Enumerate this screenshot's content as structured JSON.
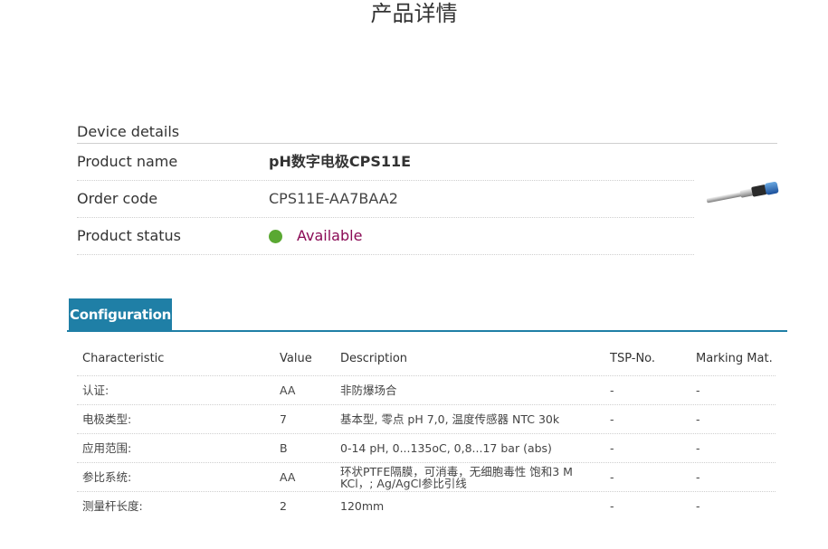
{
  "page_title": "产品详情",
  "device": {
    "heading": "Device details",
    "product_name_label": "Product name",
    "product_name_value": "pH数字电极CPS11E",
    "order_code_label": "Order code",
    "order_code_value": "CPS11E-AA7BAA2",
    "status_label": "Product status",
    "status_value": "Available",
    "status_color": "#5aa832",
    "product_image_icon": "ph-electrode-image"
  },
  "config": {
    "tab_label": "Configuration",
    "accent_color": "#1f7fa6",
    "columns": [
      "Characteristic",
      "Value",
      "Description",
      "TSP-No.",
      "Marking Mat."
    ],
    "rows": [
      {
        "characteristic": "认证:",
        "value": "AA",
        "description": "非防爆场合",
        "tsp": "-",
        "marking": "-"
      },
      {
        "characteristic": "电极类型:",
        "value": "7",
        "description": "基本型, 零点 pH 7,0, 温度传感器 NTC 30k",
        "tsp": "-",
        "marking": "-"
      },
      {
        "characteristic": "应用范围:",
        "value": "B",
        "description": "0-14 pH, 0...135oC, 0,8...17 bar (abs)",
        "tsp": "-",
        "marking": "-"
      },
      {
        "characteristic": "参比系统:",
        "value": "AA",
        "description": "环状PTFE隔膜，可消毒，无细胞毒性 饱和3 M KCl，; Ag/AgCl参比引线",
        "tsp": "-",
        "marking": "-"
      },
      {
        "characteristic": "测量杆长度:",
        "value": "2",
        "description": "120mm",
        "tsp": "-",
        "marking": "-"
      }
    ]
  }
}
